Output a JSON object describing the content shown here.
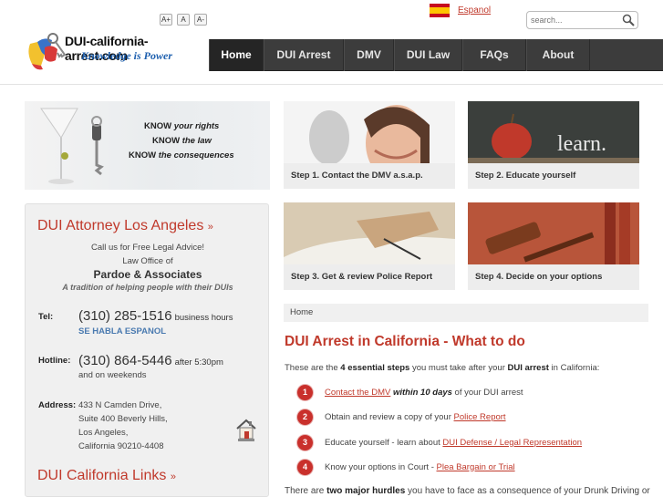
{
  "header": {
    "font_controls": [
      "A+",
      "A",
      "A-"
    ],
    "logo": {
      "title": "DUI-california-arrest.com",
      "tagline": "Knowledge is Power"
    },
    "language": {
      "label": "Espanol"
    },
    "search": {
      "placeholder": "search..."
    }
  },
  "nav": {
    "items": [
      {
        "label": "Home",
        "active": true
      },
      {
        "label": "DUI Arrest"
      },
      {
        "label": "DMV"
      },
      {
        "label": "DUI Law"
      },
      {
        "label": "FAQs"
      },
      {
        "label": "About"
      }
    ]
  },
  "promo": {
    "lines": [
      {
        "prefix": "KNOW",
        "em": "your rights"
      },
      {
        "prefix": "KNOW",
        "em": "the law"
      },
      {
        "prefix": "KNOW",
        "em": "the consequences"
      }
    ]
  },
  "steps_tiles": [
    {
      "caption": "Step 1. Contact the DMV a.s.a.p."
    },
    {
      "caption": "Step 2. Educate yourself"
    },
    {
      "caption": "Step 3. Get & review Police Report"
    },
    {
      "caption": "Step 4. Decide on your options"
    }
  ],
  "sidebar": {
    "heading": "DUI Attorney Los Angeles",
    "call_line": "Call us for Free Legal Advice!",
    "law_office": "Law Office of",
    "firm_name": "Pardoe & Associates",
    "firm_tagline": "A tradition of helping people with their DUIs",
    "tel": {
      "label": "Tel:",
      "number": "(310) 285-1516",
      "note": "business hours",
      "spanish": "SE HABLA ESPANOL"
    },
    "hotline": {
      "label": "Hotline:",
      "number": "(310) 864-5446",
      "note": "after 5:30pm",
      "note2": "and on weekends"
    },
    "address": {
      "label": "Address:",
      "lines": [
        "433 N Camden Drive,",
        "Suite 400 Beverly Hills,",
        "Los Angeles,",
        "California 90210-4408"
      ]
    },
    "links_heading": "DUI California Links"
  },
  "main": {
    "breadcrumb": "Home",
    "title": "DUI Arrest in California - What to do",
    "intro": {
      "before": "These are the ",
      "bold1": "4 essential steps",
      "middle": " you must take after your ",
      "bold2": "DUI arrest",
      "after": " in California:"
    },
    "steps": [
      {
        "num": "1",
        "link": "Contact the DMV",
        "bold": "within 10 days",
        "after": " of your DUI arrest"
      },
      {
        "num": "2",
        "before": "Obtain and review a copy of your ",
        "link": "Police Report"
      },
      {
        "num": "3",
        "before": "Educate yourself - learn about ",
        "link": "DUI Defense / Legal Representation"
      },
      {
        "num": "4",
        "before": "Know your options in Court - ",
        "link": "Plea Bargain or Trial"
      }
    ],
    "footer": {
      "before": "There are ",
      "bold": "two major hurdles",
      "after": " you have to face as a consequence of your Drunk Driving or"
    }
  },
  "colors": {
    "accent_red": "#c0392b",
    "nav_bg": "#3c3c3c",
    "nav_active": "#252525",
    "tagline_blue": "#1d5fae"
  }
}
